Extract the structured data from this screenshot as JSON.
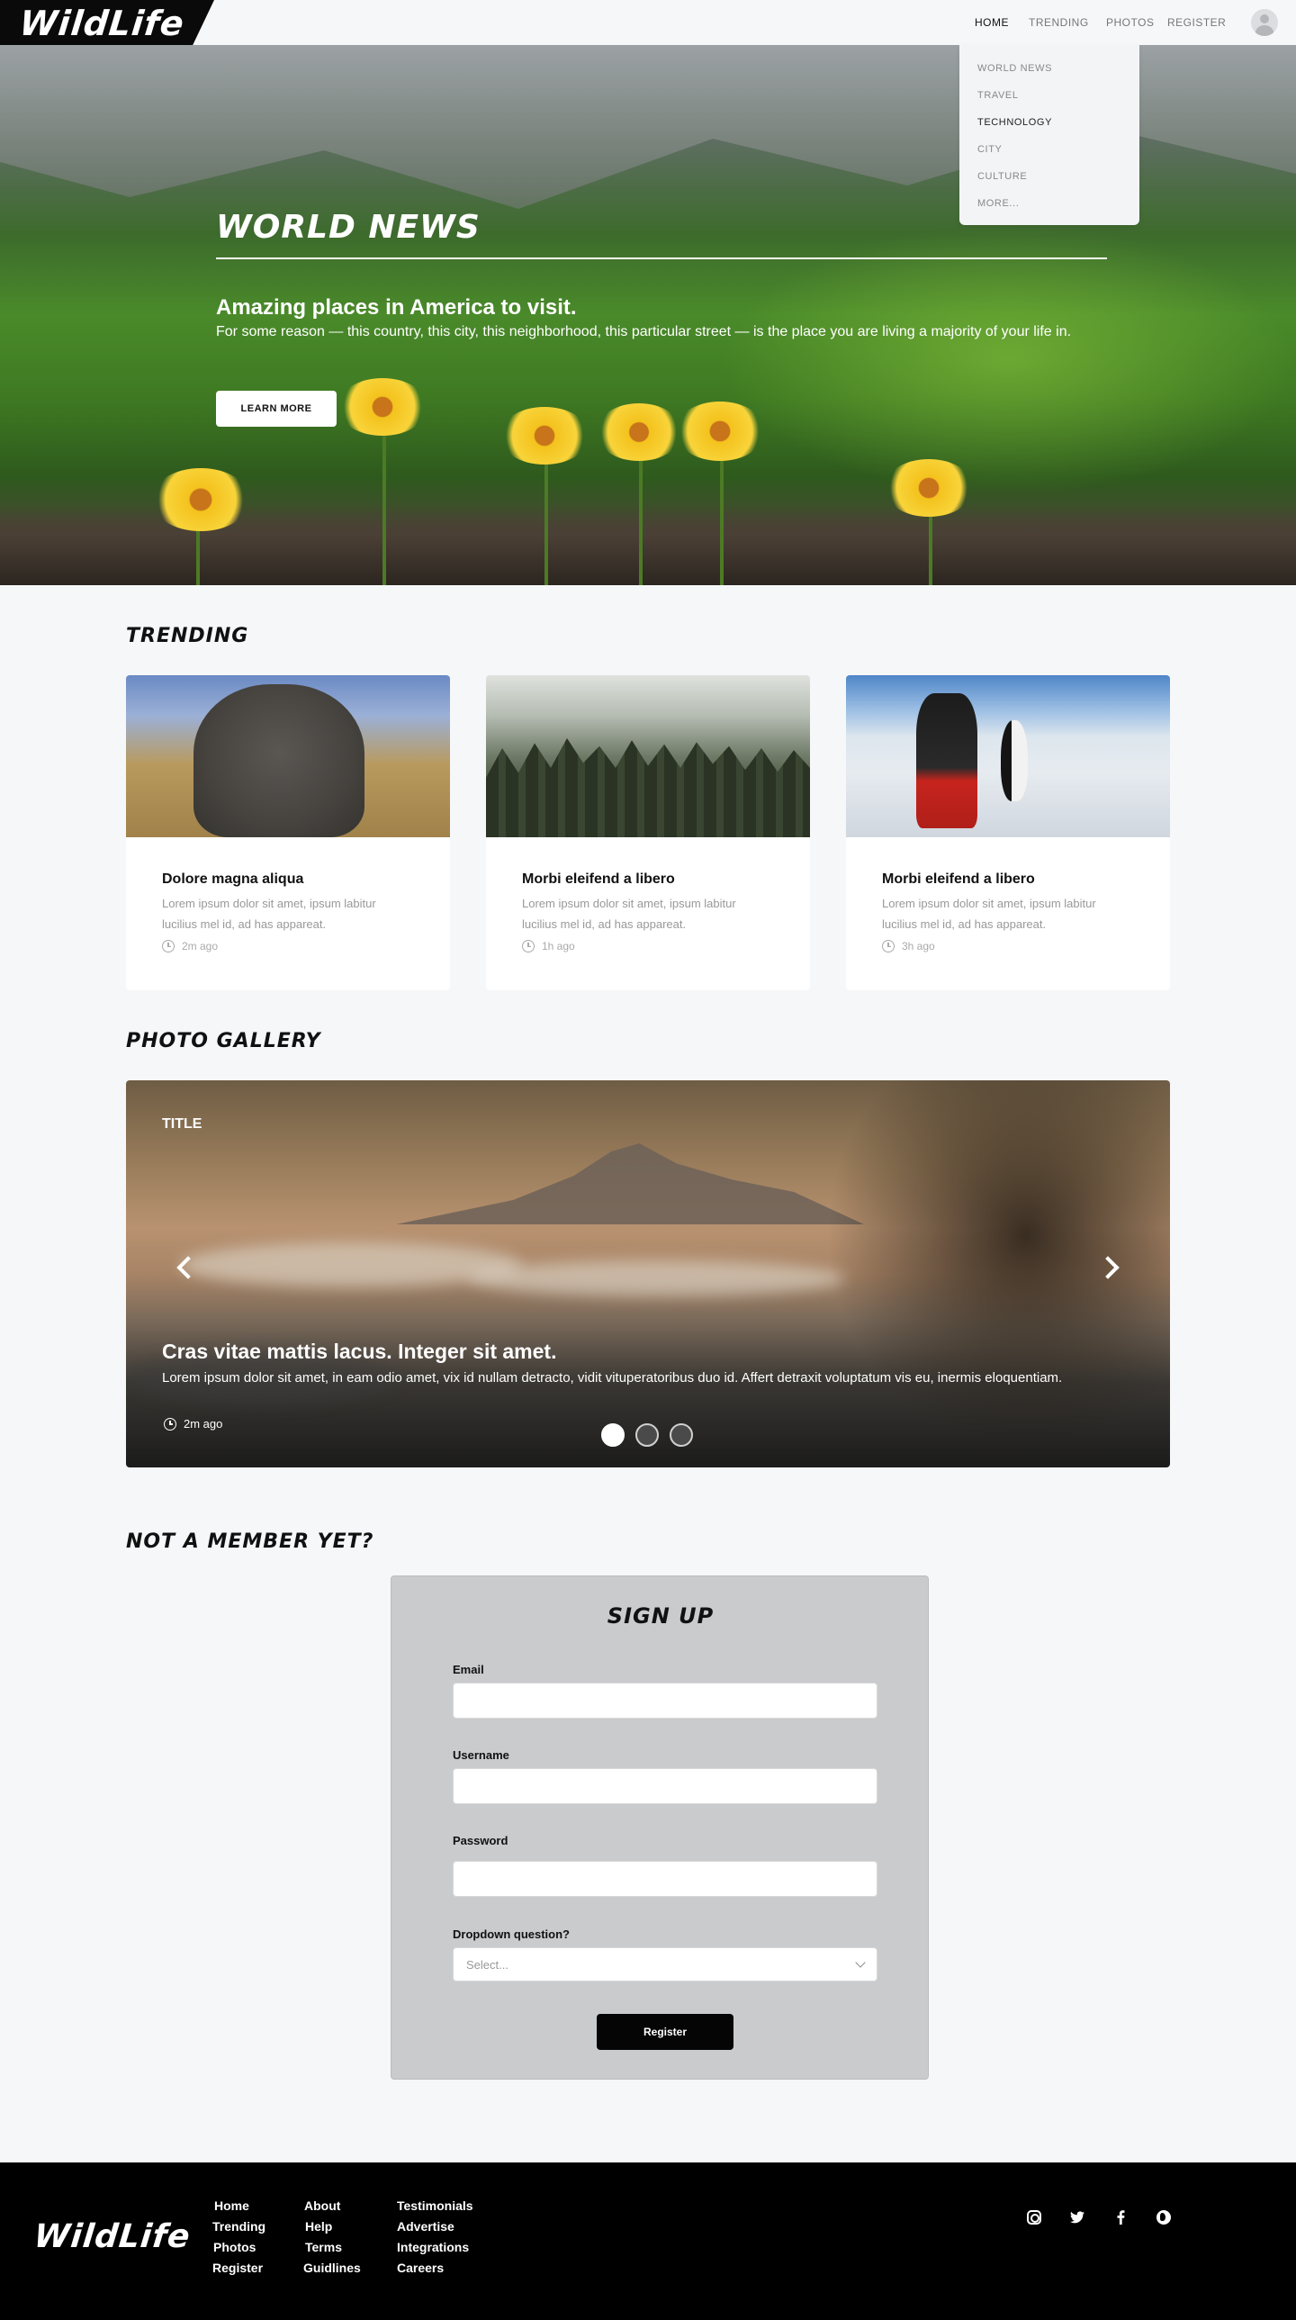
{
  "header": {
    "logo": "WildLife",
    "nav": [
      {
        "label": "HOME"
      },
      {
        "label": "TRENDING"
      },
      {
        "label": "PHOTOS"
      },
      {
        "label": "REGISTER"
      }
    ],
    "dropdown": [
      "WORLD NEWS",
      "TRAVEL",
      "TECHNOLOGY",
      "CITY",
      "CULTURE",
      "MORE..."
    ]
  },
  "hero": {
    "title": "WORLD NEWS",
    "subtitle": "Amazing places in America to visit.",
    "description": "For some reason — this country, this city, this neighborhood, this particular street — is the place you are living a majority of your life in.",
    "button": "LEARN MORE"
  },
  "trending": {
    "title": "TRENDING",
    "cards": [
      {
        "title": "Dolore magna aliqua",
        "text": "Lorem ipsum dolor sit amet, ipsum labitur lucilius mel id, ad has appareat.",
        "time": "2m ago"
      },
      {
        "title": "Morbi eleifend a libero",
        "text": "Lorem ipsum dolor sit amet, ipsum labitur lucilius mel id, ad has appareat.",
        "time": "1h ago"
      },
      {
        "title": "Morbi eleifend a libero",
        "text": "Lorem ipsum dolor sit amet, ipsum labitur lucilius mel id, ad has appareat.",
        "time": "3h ago"
      }
    ]
  },
  "gallery": {
    "title": "PHOTO GALLERY",
    "slide_title": "TITLE",
    "caption": "Cras vitae mattis lacus. Integer sit amet.",
    "description": "Lorem ipsum dolor sit amet, in eam odio amet, vix id nullam detracto, vidit vituperatoribus duo id. Affert detraxit voluptatum vis eu, inermis eloquentiam.",
    "time": "2m ago"
  },
  "signup": {
    "section_title": "NOT A MEMBER YET?",
    "title": "SIGN UP",
    "email_label": "Email",
    "username_label": "Username",
    "password_label": "Password",
    "dropdown_label": "Dropdown question?",
    "select_placeholder": "Select...",
    "button": "Register"
  },
  "footer": {
    "logo": "WildLife",
    "col1": [
      "Home",
      "Trending",
      "Photos",
      "Register"
    ],
    "col2": [
      "About",
      "Help",
      "Terms",
      "Guidlines"
    ],
    "col3": [
      "Testimonials",
      "Advertise",
      "Integrations",
      "Careers"
    ],
    "social": [
      "instagram-icon",
      "twitter-icon",
      "facebook-icon",
      "globe-icon"
    ]
  }
}
